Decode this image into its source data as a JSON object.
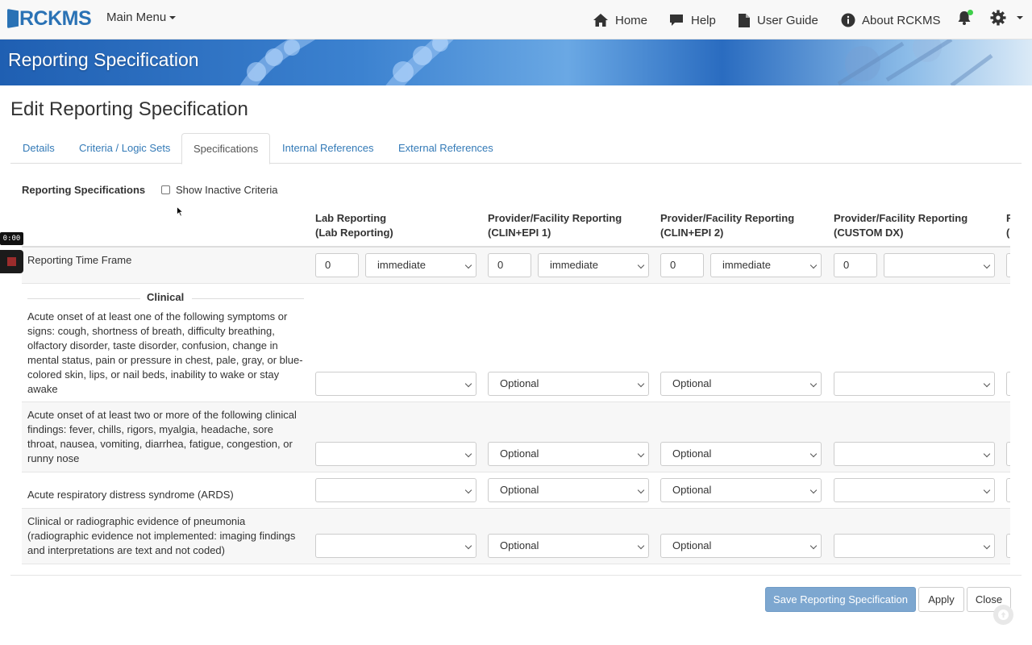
{
  "navbar": {
    "logo_text": "RCKMS",
    "main_menu": "Main Menu",
    "home": "Home",
    "help": "Help",
    "user_guide": "User Guide",
    "about": "About RCKMS"
  },
  "banner": {
    "title": "Reporting Specification"
  },
  "page": {
    "title": "Edit Reporting Specification"
  },
  "tabs": [
    "Details",
    "Criteria / Logic Sets",
    "Specifications",
    "Internal References",
    "External References"
  ],
  "active_tab": "Specifications",
  "spec": {
    "label": "Reporting Specifications",
    "show_inactive": "Show Inactive Criteria",
    "show_inactive_checked": false
  },
  "columns": [
    {
      "line1": "Lab Reporting",
      "line2": "(Lab Reporting)"
    },
    {
      "line1": "Provider/Facility Reporting",
      "line2": "(CLIN+EPI 1)"
    },
    {
      "line1": "Provider/Facility Reporting",
      "line2": "(CLIN+EPI 2)"
    },
    {
      "line1": "Provider/Facility Reporting",
      "line2": "(CUSTOM DX)"
    },
    {
      "line1": "F",
      "line2": "("
    }
  ],
  "time_frame": {
    "label": "Reporting Time Frame",
    "values": [
      "0",
      "0",
      "0",
      "0"
    ],
    "units": [
      "immediate",
      "immediate",
      "immediate",
      ""
    ]
  },
  "section_label": "Clinical",
  "criteria": [
    {
      "label": "Acute onset of at least one of the following symptoms or signs: cough, shortness of breath, difficulty breathing, olfactory disorder, taste disorder, confusion, change in mental status, pain or pressure in chest, pale, gray, or blue-colored skin, lips, or nail beds, inability to wake or stay awake",
      "selects": [
        "",
        "Optional",
        "Optional",
        ""
      ]
    },
    {
      "label": "Acute onset of at least two or more of the following clinical findings: fever, chills, rigors, myalgia, headache, sore throat, nausea, vomiting, diarrhea, fatigue, congestion, or runny nose",
      "selects": [
        "",
        "Optional",
        "Optional",
        ""
      ]
    },
    {
      "label": "Acute respiratory distress syndrome (ARDS)",
      "selects": [
        "",
        "Optional",
        "Optional",
        ""
      ]
    },
    {
      "label": "Clinical or radiographic evidence of pneumonia (radiographic evidence not implemented: imaging findings and interpretations are text and not coded)",
      "selects": [
        "",
        "Optional",
        "Optional",
        ""
      ]
    }
  ],
  "buttons": {
    "save": "Save Reporting Specification",
    "apply": "Apply",
    "close": "Close"
  },
  "recorder": {
    "time": "0:00"
  }
}
